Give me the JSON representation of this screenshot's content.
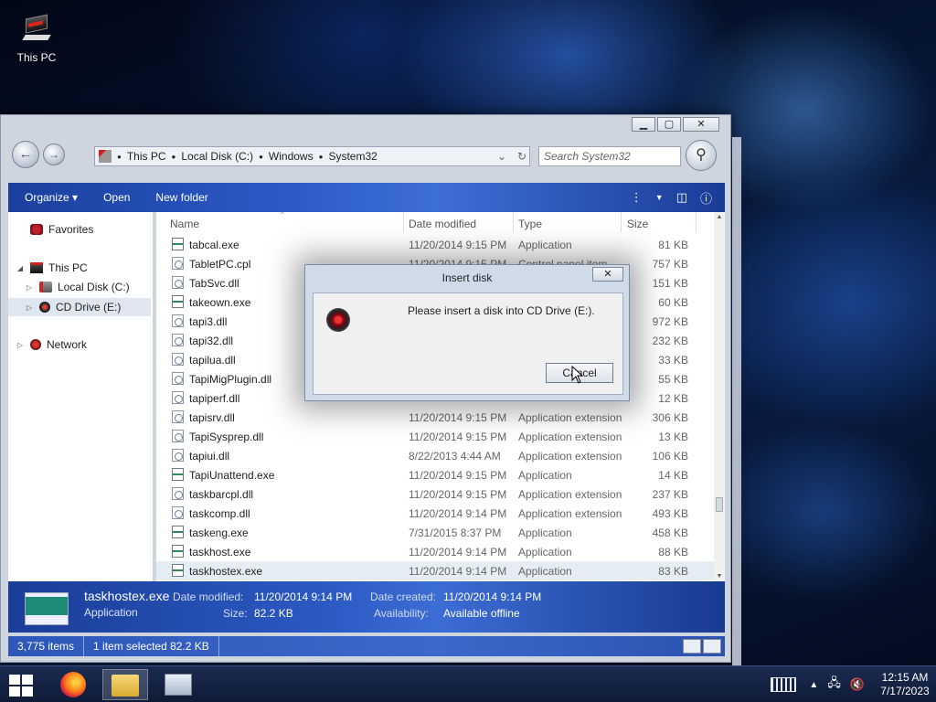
{
  "desktop": {
    "icons": [
      {
        "label": "This PC"
      }
    ]
  },
  "window": {
    "caption": {
      "minimize": "▁",
      "maximize": "▢",
      "close": "✕"
    },
    "breadcrumb": [
      "This PC",
      "Local Disk (C:)",
      "Windows",
      "System32"
    ],
    "search_placeholder": "Search System32",
    "commands": [
      "Organize ▾",
      "Open",
      "New folder"
    ],
    "nav": {
      "favorites": "Favorites",
      "this_pc": "This PC",
      "local_disk": "Local Disk (C:)",
      "cd_drive": "CD Drive (E:)",
      "network": "Network"
    },
    "columns": {
      "name": "Name",
      "date": "Date modified",
      "type": "Type",
      "size": "Size"
    },
    "files": [
      {
        "name": "tabcal.exe",
        "date": "11/20/2014 9:15 PM",
        "type": "Application",
        "size": "81 KB",
        "icon": "exe"
      },
      {
        "name": "TabletPC.cpl",
        "date": "11/20/2014 9:15 PM",
        "type": "Control panel item",
        "size": "757 KB",
        "icon": "dll"
      },
      {
        "name": "TabSvc.dll",
        "date": "",
        "type": "",
        "size": "151 KB",
        "icon": "dll"
      },
      {
        "name": "takeown.exe",
        "date": "",
        "type": "",
        "size": "60 KB",
        "icon": "exe"
      },
      {
        "name": "tapi3.dll",
        "date": "",
        "type": "",
        "size": "972 KB",
        "icon": "dll"
      },
      {
        "name": "tapi32.dll",
        "date": "",
        "type": "",
        "size": "232 KB",
        "icon": "dll"
      },
      {
        "name": "tapilua.dll",
        "date": "",
        "type": "",
        "size": "33 KB",
        "icon": "dll"
      },
      {
        "name": "TapiMigPlugin.dll",
        "date": "",
        "type": "",
        "size": "55 KB",
        "icon": "dll"
      },
      {
        "name": "tapiperf.dll",
        "date": "",
        "type": "",
        "size": "12 KB",
        "icon": "dll"
      },
      {
        "name": "tapisrv.dll",
        "date": "11/20/2014 9:15 PM",
        "type": "Application extension",
        "size": "306 KB",
        "icon": "dll"
      },
      {
        "name": "TapiSysprep.dll",
        "date": "11/20/2014 9:15 PM",
        "type": "Application extension",
        "size": "13 KB",
        "icon": "dll"
      },
      {
        "name": "tapiui.dll",
        "date": "8/22/2013 4:44 AM",
        "type": "Application extension",
        "size": "106 KB",
        "icon": "dll"
      },
      {
        "name": "TapiUnattend.exe",
        "date": "11/20/2014 9:15 PM",
        "type": "Application",
        "size": "14 KB",
        "icon": "exe"
      },
      {
        "name": "taskbarcpl.dll",
        "date": "11/20/2014 9:15 PM",
        "type": "Application extension",
        "size": "237 KB",
        "icon": "dll"
      },
      {
        "name": "taskcomp.dll",
        "date": "11/20/2014 9:14 PM",
        "type": "Application extension",
        "size": "493 KB",
        "icon": "dll"
      },
      {
        "name": "taskeng.exe",
        "date": "7/31/2015 8:37 PM",
        "type": "Application",
        "size": "458 KB",
        "icon": "exe"
      },
      {
        "name": "taskhost.exe",
        "date": "11/20/2014 9:14 PM",
        "type": "Application",
        "size": "88 KB",
        "icon": "exe"
      },
      {
        "name": "taskhostex.exe",
        "date": "11/20/2014 9:14 PM",
        "type": "Application",
        "size": "83 KB",
        "icon": "exe",
        "selected": true
      }
    ],
    "details": {
      "name": "taskhostex.exe",
      "type": "Application",
      "date_modified_label": "Date modified:",
      "date_modified": "11/20/2014 9:14 PM",
      "size_label": "Size:",
      "size": "82.2 KB",
      "date_created_label": "Date created:",
      "date_created": "11/20/2014 9:14 PM",
      "availability_label": "Availability:",
      "availability": "Available offline"
    },
    "status": {
      "items": "3,775 items",
      "selected": "1 item selected  82.2 KB"
    }
  },
  "dialog": {
    "title": "Insert disk",
    "close": "✕",
    "message": "Please insert a disk into CD Drive (E:).",
    "cancel": "Cancel"
  },
  "taskbar": {
    "time": "12:15 AM",
    "date": "7/17/2023"
  }
}
